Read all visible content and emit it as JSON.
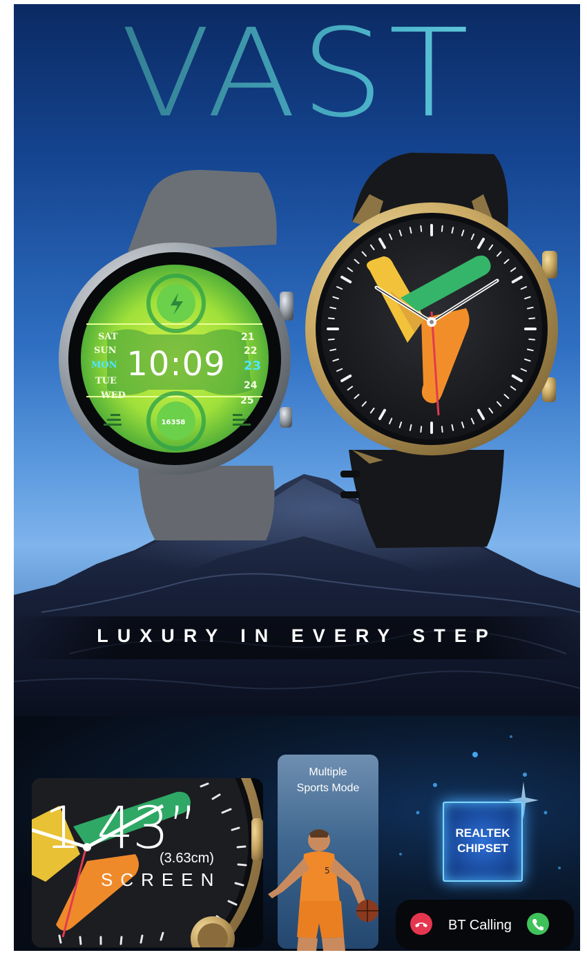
{
  "hero": {
    "brand": "VAST",
    "tagline": "LUXURY IN EVERY STEP"
  },
  "left_watch_face": {
    "time": "10:09",
    "days": [
      "SAT",
      "SUN",
      "MON",
      "TUE",
      "WED"
    ],
    "active_day": "MON",
    "dates": [
      "21",
      "22",
      "23",
      "24",
      "25"
    ],
    "active_date": "23",
    "steps": "16358",
    "accent": "#9ee64a"
  },
  "features": {
    "screen": {
      "size": "1.43”",
      "metric": "(3.63cm)",
      "label": "SCREEN"
    },
    "sports": {
      "line1": "Multiple",
      "line2": "Sports Mode"
    },
    "chipset": {
      "line1": "REALTEK",
      "line2": "CHIPSET"
    },
    "calling": {
      "label": "BT Calling",
      "decline_icon": "phone-decline-icon",
      "accept_icon": "phone-accept-icon"
    }
  },
  "colors": {
    "sky_top": "#0b2a63",
    "sky_bottom": "#7fb4ec",
    "brand_gradient": [
      "#2a6a82",
      "#7fe0ee"
    ],
    "gold_bezel": "#c9a862",
    "decline": "#e5364f",
    "accept": "#3fc25a"
  }
}
